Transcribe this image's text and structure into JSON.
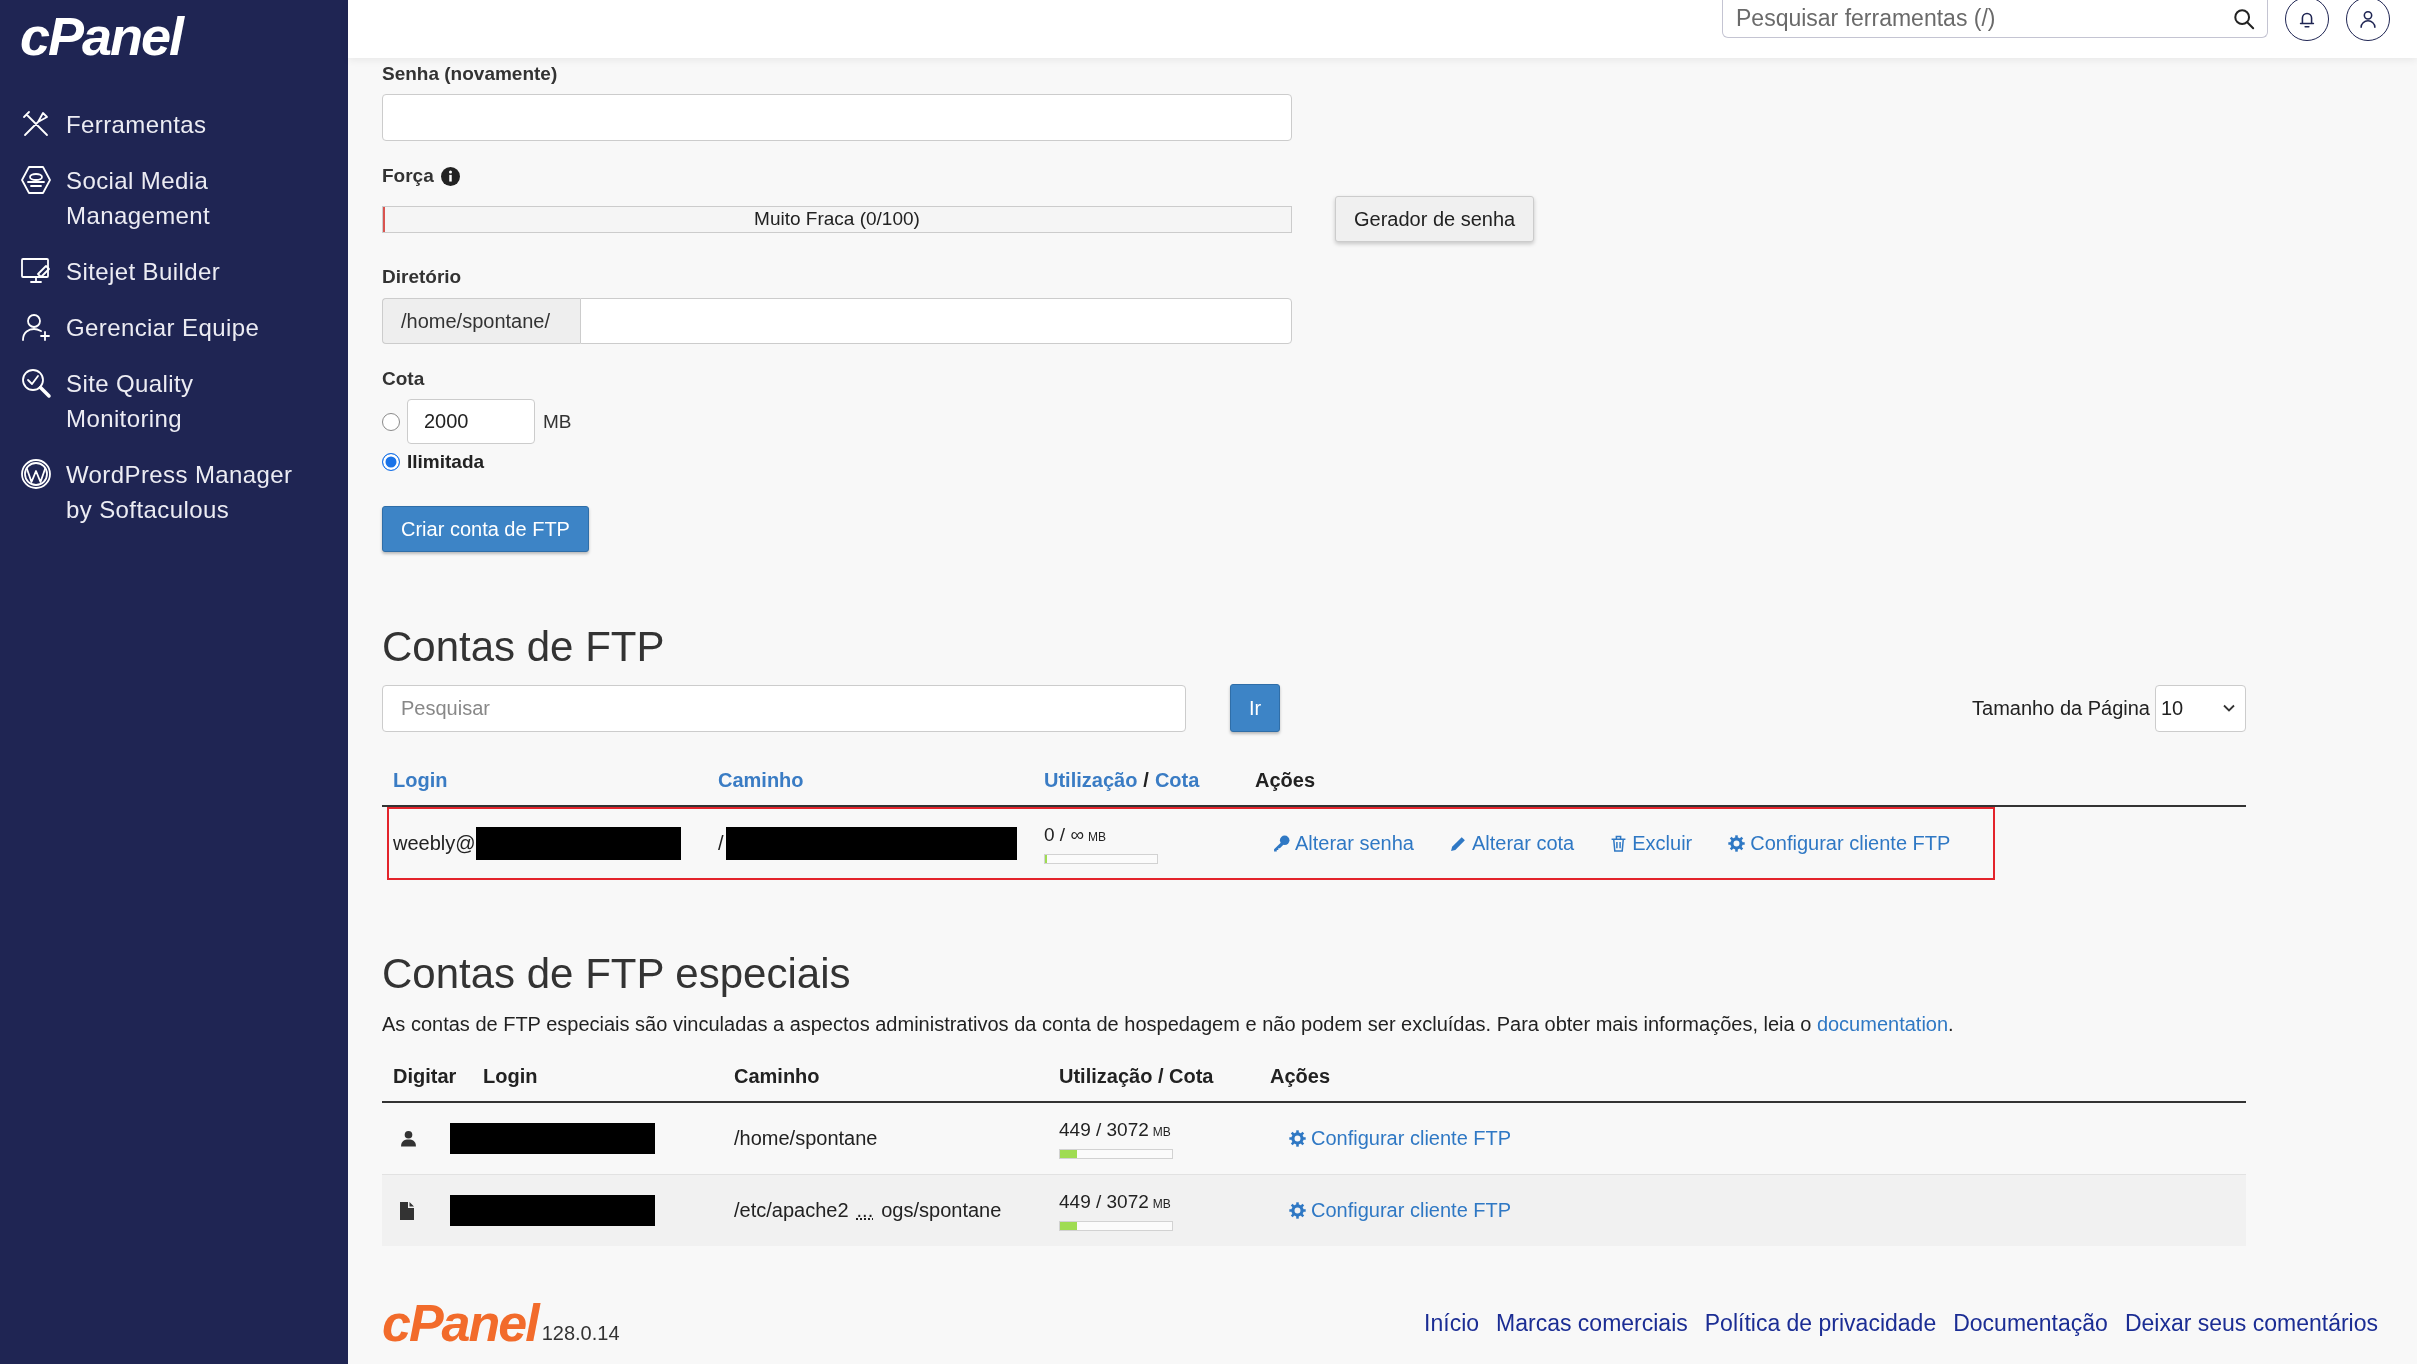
{
  "sidebar": {
    "logo": "cPanel",
    "items": [
      {
        "kind": "tools",
        "lines": [
          "Ferramentas"
        ]
      },
      {
        "kind": "social",
        "lines": [
          "Social Media",
          "Management"
        ]
      },
      {
        "kind": "sitejet",
        "lines": [
          "Sitejet Builder"
        ]
      },
      {
        "kind": "team",
        "lines": [
          "Gerenciar Equipe"
        ]
      },
      {
        "kind": "quality",
        "lines": [
          "Site Quality",
          "Monitoring"
        ]
      },
      {
        "kind": "wordpress",
        "lines": [
          "WordPress Manager",
          "by Softaculous"
        ]
      }
    ]
  },
  "header": {
    "search": {
      "placeholder": "Pesquisar ferramentas (/)"
    }
  },
  "form": {
    "password_confirm": {
      "label": "Senha (novamente)"
    },
    "strength": {
      "label": "Força",
      "level": 0,
      "reading": "Muito Fraca (0/100)"
    },
    "generator_button": "Gerador de senha",
    "directory": {
      "label": "Diretório",
      "prefix": "/home/spontane/"
    },
    "quota": {
      "label": "Cota",
      "options": [
        {
          "kind": "limit",
          "value": "2000",
          "unit": "MB",
          "selected": false
        },
        {
          "kind": "unlimited",
          "label": "Ilimitada",
          "selected": true
        }
      ]
    },
    "submit_button": "Criar conta de FTP"
  },
  "ftp_accounts": {
    "title": "Contas de FTP",
    "search": {
      "placeholder": "Pesquisar"
    },
    "go_button": "Ir",
    "page_size": {
      "label": "Tamanho da Página",
      "value": "10"
    },
    "columns": [
      {
        "label": "Login",
        "sortable": true
      },
      {
        "label": "Caminho",
        "sortable": true
      },
      {
        "label": "Utilização",
        "separator": "/",
        "label_2": "Cota",
        "sortable": true
      },
      {
        "label": "Ações",
        "sortable": false
      }
    ],
    "rows": [
      {
        "highlighted": true,
        "login": "weebly@",
        "login_redacted": true,
        "path": "/",
        "path_redacted": true,
        "usage": "0 / ∞",
        "unit": "MB",
        "level": 0,
        "actions": [
          {
            "kind": "key",
            "label": "Alterar senha"
          },
          {
            "kind": "pencil",
            "label": "Alterar cota"
          },
          {
            "kind": "trash",
            "label": "Excluir"
          },
          {
            "kind": "gear",
            "label": "Configurar cliente FTP"
          }
        ]
      }
    ]
  },
  "special_accounts": {
    "title": "Contas de FTP especiais",
    "description": {
      "text": "As contas de FTP especiais são vinculadas a aspectos administrativos da conta de hospedagem e não podem ser excluídas. Para obter mais informações, leia o",
      "link": "documentation",
      "end": "."
    },
    "columns": [
      "Digitar",
      "Login",
      "Caminho",
      "Utilização / Cota",
      "Ações"
    ],
    "rows": [
      {
        "kind": "user",
        "login_redacted": true,
        "path": "/home/spontane",
        "usage": "449 / 3072",
        "unit": "MB",
        "level": 0.15,
        "action": "Configurar cliente FTP"
      },
      {
        "kind": "file",
        "login_redacted": true,
        "path": "/etc/apache2",
        "path_toggle": "...",
        "path_end": "ogs/spontane",
        "usage": "449 / 3072",
        "unit": "MB",
        "level": 0.15,
        "action": "Configurar cliente FTP"
      }
    ]
  },
  "footer": {
    "logo": "cPanel",
    "version": "128.0.14",
    "links": [
      "Início",
      "Marcas comerciais",
      "Política de privacidade",
      "Documentação",
      "Deixar seus comentários"
    ]
  }
}
